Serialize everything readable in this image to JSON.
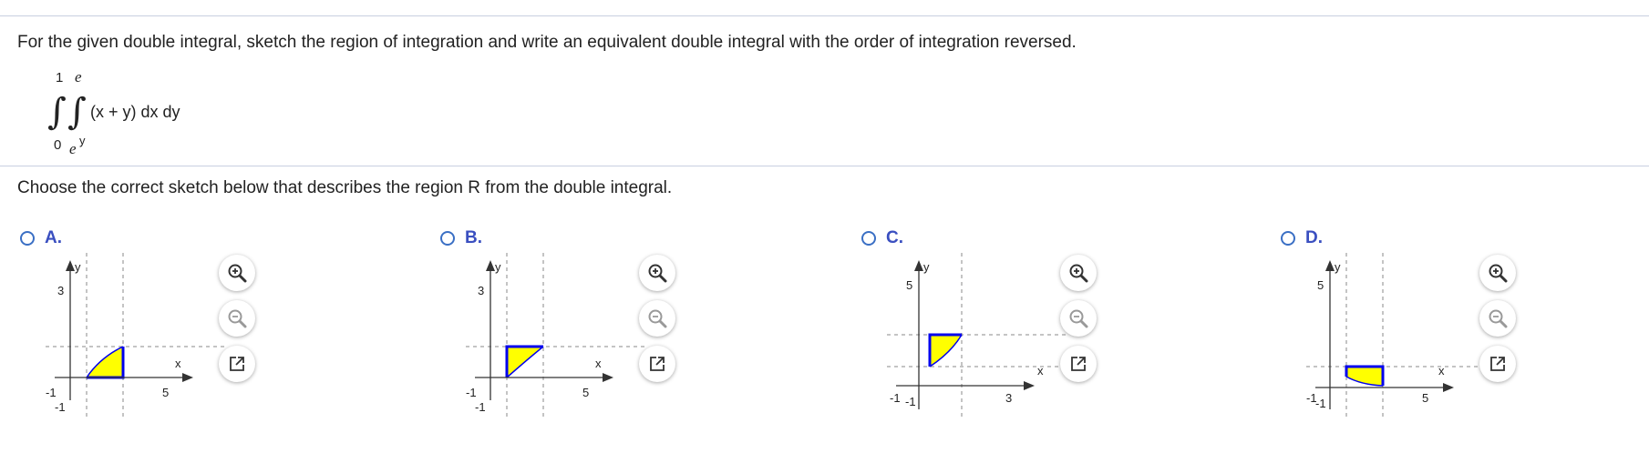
{
  "question": "For the given double integral, sketch the region of integration and write an equivalent double integral with the order of integration reversed.",
  "integral": {
    "outer_upper": "1",
    "outer_lower": "0",
    "inner_upper": "e",
    "inner_lower_base": "e",
    "inner_lower_exp": "y",
    "integrand": "(x + y) dx dy"
  },
  "sub_question": "Choose the correct sketch below that describes the region R from the double integral.",
  "colors": {
    "accent": "#3a4fc0",
    "fill": "#ffff00",
    "stroke": "#0000ee"
  },
  "options": [
    {
      "label": "A.",
      "y_label": "y",
      "x_label": "x",
      "y_tick_top": "3",
      "y_tick_bottom": "-1",
      "x_tick_left": "-1",
      "x_tick_right": "5"
    },
    {
      "label": "B.",
      "y_label": "y",
      "x_label": "x",
      "y_tick_top": "3",
      "y_tick_bottom": "-1",
      "x_tick_left": "-1",
      "x_tick_right": "5"
    },
    {
      "label": "C.",
      "y_label": "y",
      "x_label": "x",
      "y_tick_top": "5",
      "y_tick_bottom": "-1",
      "x_tick_left": "-1",
      "x_tick_right": "3"
    },
    {
      "label": "D.",
      "y_label": "y",
      "x_label": "x",
      "y_tick_top": "5",
      "y_tick_bottom": "-1",
      "x_tick_left": "-1",
      "x_tick_right": "5"
    }
  ],
  "tools": {
    "zoom_in": "zoom-in-icon",
    "zoom_out": "zoom-out-icon",
    "pop_out": "pop-out-icon"
  }
}
